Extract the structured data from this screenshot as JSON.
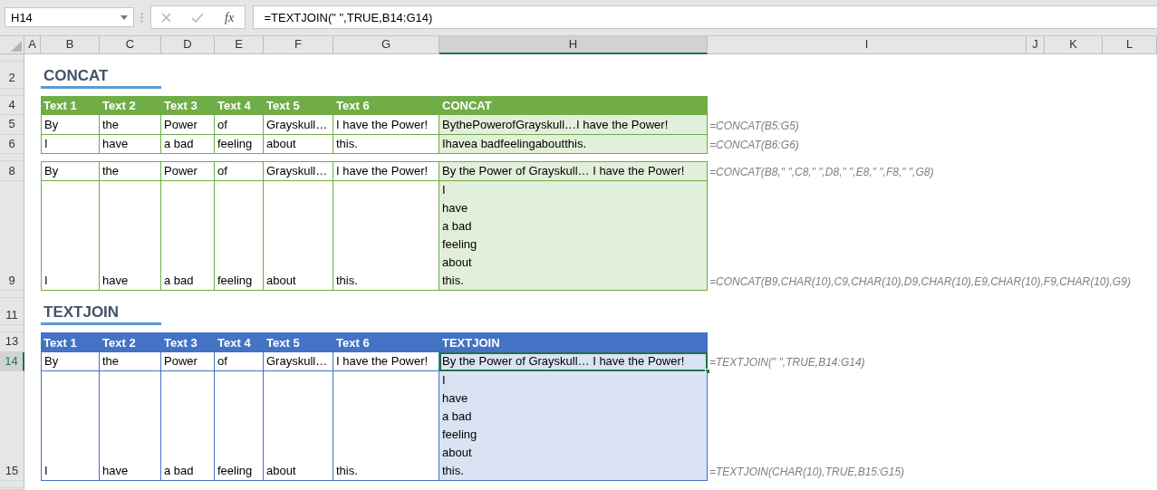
{
  "name_box": "H14",
  "fx_label": "fx",
  "formula": "=TEXTJOIN(\" \",TRUE,B14:G14)",
  "columns": [
    {
      "label": "A",
      "selected": false
    },
    {
      "label": "B",
      "selected": false
    },
    {
      "label": "C",
      "selected": false
    },
    {
      "label": "D",
      "selected": false
    },
    {
      "label": "E",
      "selected": false
    },
    {
      "label": "F",
      "selected": false
    },
    {
      "label": "G",
      "selected": false
    },
    {
      "label": "H",
      "selected": true
    },
    {
      "label": "I",
      "selected": false
    },
    {
      "label": "J",
      "selected": false
    },
    {
      "label": "K",
      "selected": false
    },
    {
      "label": "L",
      "selected": false
    }
  ],
  "rows": [
    {
      "kind": "spacer"
    },
    {
      "kind": "title",
      "label": "2",
      "selected": false,
      "title": "CONCAT"
    },
    {
      "kind": "spacer"
    },
    {
      "kind": "header",
      "label": "4",
      "selected": false,
      "color": "#70ad47",
      "cells": [
        "Text 1",
        "Text 2",
        "Text 3",
        "Text 4",
        "Text 5",
        "Text 6",
        "CONCAT"
      ]
    },
    {
      "kind": "data",
      "label": "5",
      "selected": false,
      "cells": [
        "By",
        "the",
        "Power",
        "of",
        "Grayskull…",
        "I have the Power!"
      ],
      "result": "BythePowerofGrayskull…I have the Power!",
      "note": "=CONCAT(B5:G5)"
    },
    {
      "kind": "data",
      "label": "6",
      "selected": false,
      "cells": [
        "I",
        "have",
        "a bad",
        "feeling",
        "about",
        "this."
      ],
      "result": "Ihavea badfeelingaboutthis.",
      "note": "=CONCAT(B6:G6)"
    },
    {
      "kind": "spacer"
    },
    {
      "kind": "data",
      "label": "8",
      "selected": false,
      "cells": [
        "By",
        "the",
        "Power",
        "of",
        "Grayskull…",
        "I have the Power!"
      ],
      "result": "By the Power of Grayskull… I have the Power!",
      "note": "=CONCAT(B8,\" \",C8,\" \",D8,\" \",E8,\" \",F8,\" \",G8)"
    },
    {
      "kind": "data",
      "label": "9",
      "selected": false,
      "cells": [
        "I",
        "have",
        "a bad",
        "feeling",
        "about",
        "this."
      ],
      "result": "I\nhave\na bad\nfeeling\nabout\nthis.",
      "note": "=CONCAT(B9,CHAR(10),C9,CHAR(10),D9,CHAR(10),E9,CHAR(10),F9,CHAR(10),G9)"
    },
    {
      "kind": "spacer"
    },
    {
      "kind": "title",
      "label": "11",
      "selected": false,
      "title": "TEXTJOIN"
    },
    {
      "kind": "spacer"
    },
    {
      "kind": "header",
      "label": "13",
      "selected": false,
      "color": "#4472c4",
      "cells": [
        "Text 1",
        "Text 2",
        "Text 3",
        "Text 4",
        "Text 5",
        "Text 6",
        "TEXTJOIN"
      ]
    },
    {
      "kind": "data",
      "label": "14",
      "selected": true,
      "cells": [
        "By",
        "the",
        "Power",
        "of",
        "Grayskull…",
        "I have the Power!"
      ],
      "result": "By the Power of Grayskull… I have the Power!",
      "note": "=TEXTJOIN(\" \",TRUE,B14:G14)"
    },
    {
      "kind": "data",
      "label": "15",
      "selected": false,
      "cells": [
        "I",
        "have",
        "a bad",
        "feeling",
        "about",
        "this."
      ],
      "result": "I\nhave\na bad\nfeeling\nabout\nthis.",
      "note": "=TEXTJOIN(CHAR(10),TRUE,B15:G15)"
    },
    {
      "kind": "spacer"
    }
  ]
}
